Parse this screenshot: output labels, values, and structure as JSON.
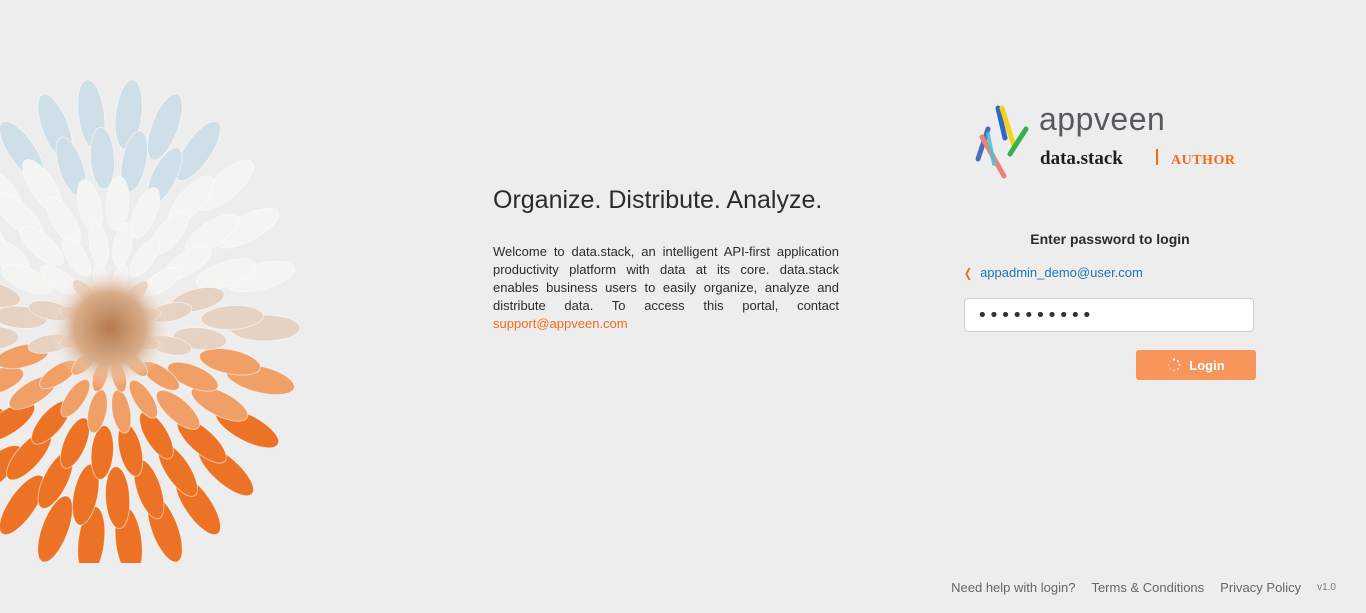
{
  "hero": {
    "title": "Organize. Distribute. Analyze.",
    "description": "Welcome to data.stack, an intelligent API-first application productivity platform with data at its core. data.stack enables business users to easily organize, analyze and distribute data. To access this portal, contact",
    "support_email": "support@appveen.com"
  },
  "logo": {
    "brand": "appveen",
    "product": "data.stack",
    "role": "AUTHOR"
  },
  "login": {
    "title": "Enter password to login",
    "user_email": "appadmin_demo@user.com",
    "password_value": "••••••••••",
    "button_label": "Login"
  },
  "footer": {
    "help": "Need help with login?",
    "terms": "Terms & Conditions",
    "privacy": "Privacy Policy",
    "version": "v1.0"
  },
  "colors": {
    "accent": "#f26b1d",
    "button": "#f7955b",
    "link": "#1f73b7",
    "background": "#ededed"
  },
  "icons": {
    "back": "chevron-left-icon",
    "loading": "spinner-icon"
  }
}
